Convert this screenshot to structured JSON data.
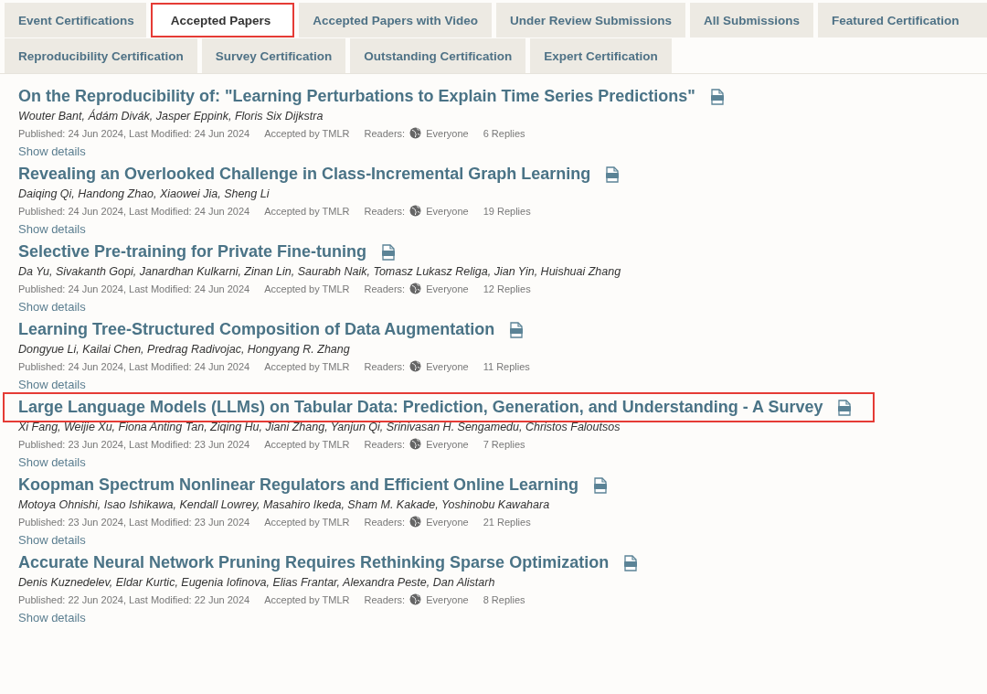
{
  "tabs": [
    {
      "label": "Event Certifications",
      "selected": false,
      "highlighted": false
    },
    {
      "label": "Accepted Papers",
      "selected": true,
      "highlighted": true
    },
    {
      "label": "Accepted Papers with Video",
      "selected": false,
      "highlighted": false
    },
    {
      "label": "Under Review Submissions",
      "selected": false,
      "highlighted": false
    },
    {
      "label": "All Submissions",
      "selected": false,
      "highlighted": false
    },
    {
      "label": "Featured Certification",
      "selected": false,
      "highlighted": false
    },
    {
      "label": "Reproducibility Certification",
      "selected": false,
      "highlighted": false
    },
    {
      "label": "Survey Certification",
      "selected": false,
      "highlighted": false
    },
    {
      "label": "Outstanding Certification",
      "selected": false,
      "highlighted": false
    },
    {
      "label": "Expert Certification",
      "selected": false,
      "highlighted": false
    }
  ],
  "papers": [
    {
      "title": "On the Reproducibility of: \"Learning Perturbations to Explain Time Series Predictions\"",
      "highlighted": false,
      "authors": "Wouter Bant, Ádám Divák, Jasper Eppink, Floris Six Dijkstra",
      "dates": "Published: 24 Jun 2024, Last Modified: 24 Jun 2024",
      "venue": "Accepted by TMLR",
      "readers_label": "Readers:",
      "readers": "Everyone",
      "replies": "6 Replies",
      "details": "Show details"
    },
    {
      "title": "Revealing an Overlooked Challenge in Class-Incremental Graph Learning",
      "highlighted": false,
      "authors": "Daiqing Qi, Handong Zhao, Xiaowei Jia, Sheng Li",
      "dates": "Published: 24 Jun 2024, Last Modified: 24 Jun 2024",
      "venue": "Accepted by TMLR",
      "readers_label": "Readers:",
      "readers": "Everyone",
      "replies": "19 Replies",
      "details": "Show details"
    },
    {
      "title": "Selective Pre-training for Private Fine-tuning",
      "highlighted": false,
      "authors": "Da Yu, Sivakanth Gopi, Janardhan Kulkarni, Zinan Lin, Saurabh Naik, Tomasz Lukasz Religa, Jian Yin, Huishuai Zhang",
      "dates": "Published: 24 Jun 2024, Last Modified: 24 Jun 2024",
      "venue": "Accepted by TMLR",
      "readers_label": "Readers:",
      "readers": "Everyone",
      "replies": "12 Replies",
      "details": "Show details"
    },
    {
      "title": "Learning Tree-Structured Composition of Data Augmentation",
      "highlighted": false,
      "authors": "Dongyue Li, Kailai Chen, Predrag Radivojac, Hongyang R. Zhang",
      "dates": "Published: 24 Jun 2024, Last Modified: 24 Jun 2024",
      "venue": "Accepted by TMLR",
      "readers_label": "Readers:",
      "readers": "Everyone",
      "replies": "11 Replies",
      "details": "Show details"
    },
    {
      "title": "Large Language Models (LLMs) on Tabular Data: Prediction, Generation, and Understanding - A Survey",
      "highlighted": true,
      "authors": "Xi Fang, Weijie Xu, Fiona Anting Tan, Ziqing Hu, Jiani Zhang, Yanjun Qi, Srinivasan H. Sengamedu, Christos Faloutsos",
      "dates": "Published: 23 Jun 2024, Last Modified: 23 Jun 2024",
      "venue": "Accepted by TMLR",
      "readers_label": "Readers:",
      "readers": "Everyone",
      "replies": "7 Replies",
      "details": "Show details"
    },
    {
      "title": "Koopman Spectrum Nonlinear Regulators and Efficient Online Learning",
      "highlighted": false,
      "authors": "Motoya Ohnishi, Isao Ishikawa, Kendall Lowrey, Masahiro Ikeda, Sham M. Kakade, Yoshinobu Kawahara",
      "dates": "Published: 23 Jun 2024, Last Modified: 23 Jun 2024",
      "venue": "Accepted by TMLR",
      "readers_label": "Readers:",
      "readers": "Everyone",
      "replies": "21 Replies",
      "details": "Show details"
    },
    {
      "title": "Accurate Neural Network Pruning Requires Rethinking Sparse Optimization",
      "highlighted": false,
      "authors": "Denis Kuznedelev, Eldar Kurtic, Eugenia Iofinova, Elias Frantar, Alexandra Peste, Dan Alistarh",
      "dates": "Published: 22 Jun 2024, Last Modified: 22 Jun 2024",
      "venue": "Accepted by TMLR",
      "readers_label": "Readers:",
      "readers": "Everyone",
      "replies": "8 Replies",
      "details": "Show details"
    }
  ]
}
